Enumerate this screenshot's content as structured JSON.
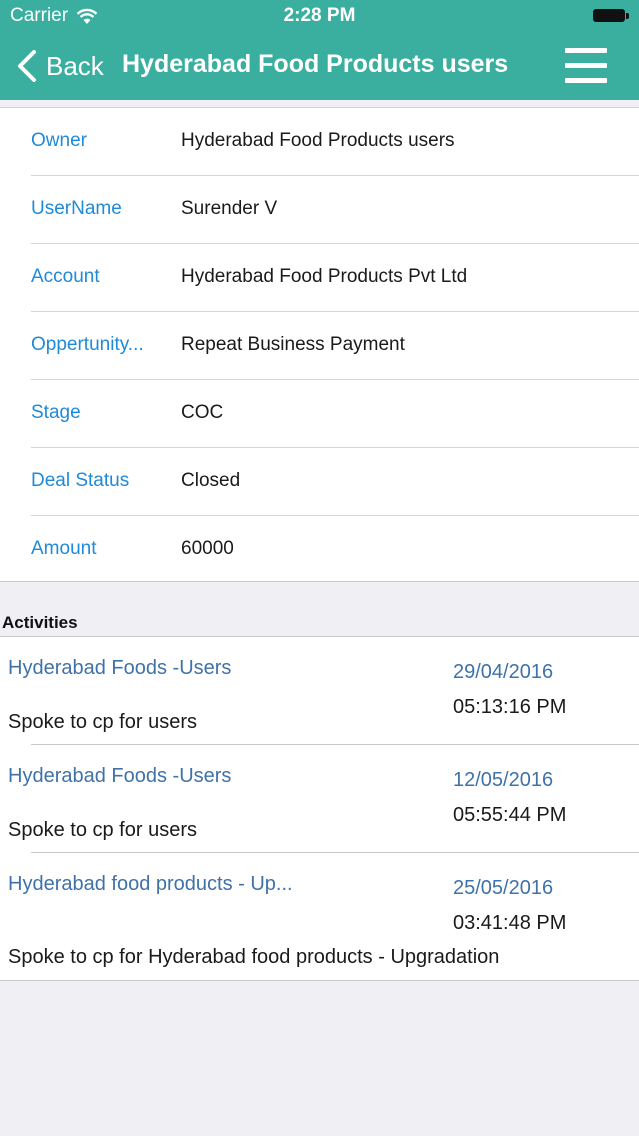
{
  "status_bar": {
    "carrier": "Carrier",
    "time": "2:28 PM"
  },
  "nav": {
    "back_label": "Back",
    "title": "Hyderabad Food Products users"
  },
  "details": [
    {
      "label": "Owner",
      "value": "Hyderabad Food Products users"
    },
    {
      "label": "UserName",
      "value": "Surender V"
    },
    {
      "label": "Account",
      "value": "Hyderabad Food Products Pvt Ltd"
    },
    {
      "label": "Oppertunity...",
      "value": "Repeat Business Payment"
    },
    {
      "label": "Stage",
      "value": "COC"
    },
    {
      "label": "Deal Status",
      "value": "Closed"
    },
    {
      "label": "Amount",
      "value": "60000"
    }
  ],
  "activities_section": {
    "title": "Activities",
    "items": [
      {
        "title": "Hyderabad Foods -Users",
        "date": "29/04/2016",
        "time": "05:13:16 PM",
        "description": "Spoke to cp for users"
      },
      {
        "title": "Hyderabad Foods -Users",
        "date": "12/05/2016",
        "time": "05:55:44 PM",
        "description": "Spoke to cp for users"
      },
      {
        "title": "Hyderabad food products - Up...",
        "date": "25/05/2016",
        "time": "03:41:48 PM",
        "description": "Spoke to cp for Hyderabad food products - Upgradation"
      }
    ]
  },
  "colors": {
    "header_bg": "#3aaf9f",
    "label_blue": "#1f8ad8",
    "activity_blue": "#3f72a8",
    "page_bg": "#efeff4"
  },
  "icons": {
    "wifi": "wifi-icon",
    "battery": "battery-icon",
    "back": "chevron-left-icon",
    "menu": "hamburger-menu-icon"
  }
}
